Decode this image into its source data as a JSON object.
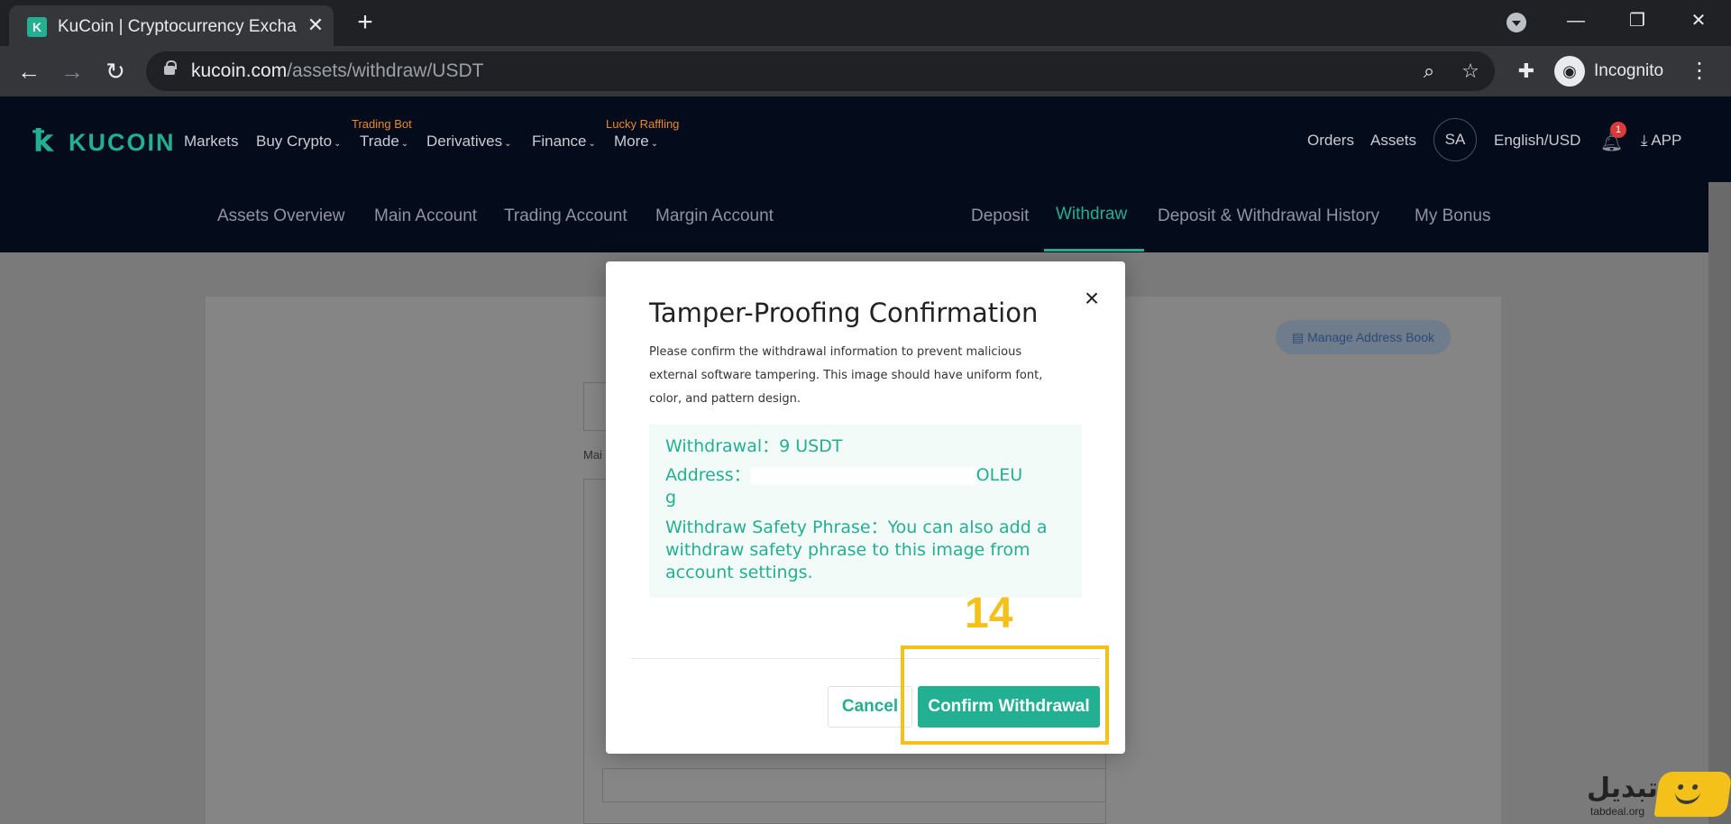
{
  "browser": {
    "tab_title": "KuCoin | Cryptocurrency Exchang",
    "tab_favicon": "K",
    "new_tab": "+",
    "url_host": "kucoin.com",
    "url_path": "/assets/withdraw/USDT",
    "incognito_label": "Incognito"
  },
  "site": {
    "logo_text": "KUCOIN",
    "nav": [
      {
        "label": "Markets"
      },
      {
        "label": "Buy Crypto"
      },
      {
        "label": "Trade",
        "badge": "Trading Bot"
      },
      {
        "label": "Derivatives"
      },
      {
        "label": "Finance"
      },
      {
        "label": "More",
        "badge": "Lucky Raffling"
      }
    ],
    "header_right": {
      "orders": "Orders",
      "assets": "Assets",
      "avatar": "SA",
      "language": "English/USD",
      "notif_count": "1",
      "app": "APP"
    },
    "subnav": [
      {
        "label": "Assets Overview"
      },
      {
        "label": "Main Account"
      },
      {
        "label": "Trading Account"
      },
      {
        "label": "Margin Account"
      },
      {
        "label": "Deposit"
      },
      {
        "label": "Withdraw",
        "active": true
      },
      {
        "label": "Deposit & Withdrawal History"
      },
      {
        "label": "My Bonus"
      }
    ]
  },
  "page": {
    "manage_address_book": "Manage Address Book",
    "side_label_main": "Mai"
  },
  "modal": {
    "title": "Tamper-Proofing Confirmation",
    "close": "×",
    "description": "Please confirm the withdrawal information to prevent malicious external software tampering. This image should have uniform font, color, and pattern design.",
    "withdrawal_line": "Withdrawal：9 USDT",
    "address_label": "Address：",
    "address_visible_end": "OLEU",
    "address_wrap": "g",
    "safety_line": "Withdraw Safety Phrase：You can also add a withdraw safety phrase to this image from account settings.",
    "cancel": "Cancel",
    "confirm": "Confirm Withdrawal"
  },
  "annotation": {
    "step_number": "14",
    "color": "#f4c01a"
  },
  "watermark": {
    "brand": "تبدیل",
    "url": "tabdeal.org"
  },
  "colors": {
    "accent": "#23af91",
    "header_bg": "#040b1b"
  }
}
